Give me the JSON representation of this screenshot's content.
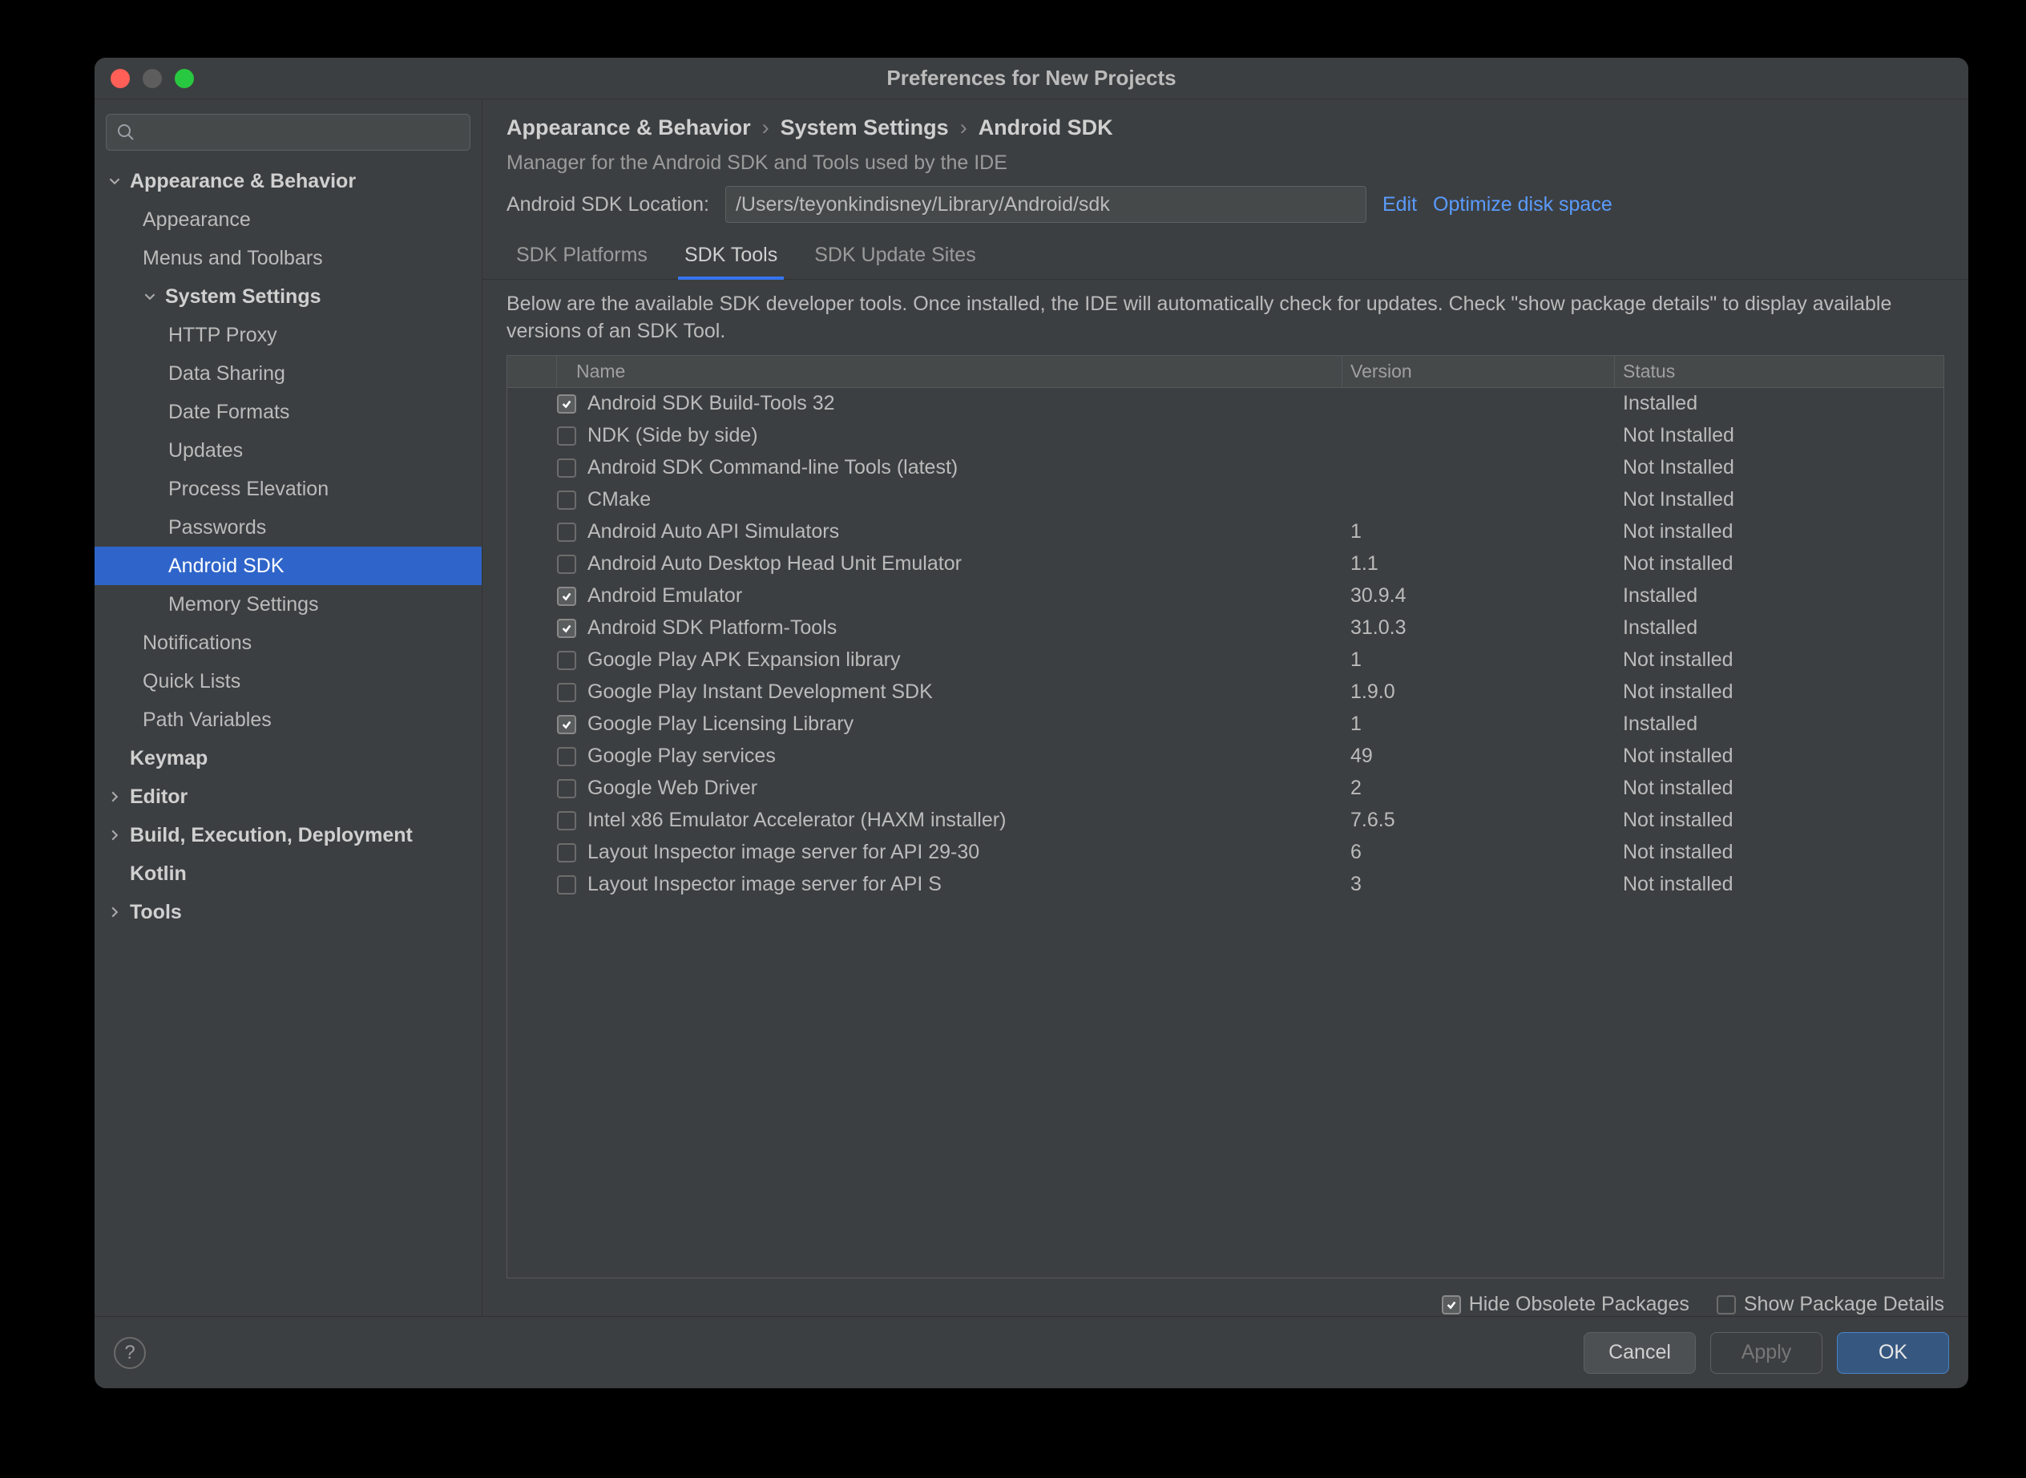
{
  "window": {
    "title": "Preferences for New Projects"
  },
  "sidebar": {
    "search_placeholder": "",
    "items": [
      {
        "label": "Appearance & Behavior",
        "bold": true,
        "expander": "down",
        "indent": 0
      },
      {
        "label": "Appearance",
        "indent": 1
      },
      {
        "label": "Menus and Toolbars",
        "indent": 1
      },
      {
        "label": "System Settings",
        "bold": true,
        "expander": "down",
        "indent": 1
      },
      {
        "label": "HTTP Proxy",
        "indent": 2
      },
      {
        "label": "Data Sharing",
        "indent": 2
      },
      {
        "label": "Date Formats",
        "indent": 2
      },
      {
        "label": "Updates",
        "indent": 2
      },
      {
        "label": "Process Elevation",
        "indent": 2
      },
      {
        "label": "Passwords",
        "indent": 2
      },
      {
        "label": "Android SDK",
        "indent": 2,
        "selected": true
      },
      {
        "label": "Memory Settings",
        "indent": 2
      },
      {
        "label": "Notifications",
        "indent": 1
      },
      {
        "label": "Quick Lists",
        "indent": 1
      },
      {
        "label": "Path Variables",
        "indent": 1
      },
      {
        "label": "Keymap",
        "bold": true,
        "indent": 0
      },
      {
        "label": "Editor",
        "bold": true,
        "expander": "right",
        "indent": 0
      },
      {
        "label": "Build, Execution, Deployment",
        "bold": true,
        "expander": "right",
        "indent": 0
      },
      {
        "label": "Kotlin",
        "bold": true,
        "indent": 0
      },
      {
        "label": "Tools",
        "bold": true,
        "expander": "right",
        "indent": 0
      }
    ]
  },
  "breadcrumb": {
    "a": "Appearance & Behavior",
    "b": "System Settings",
    "c": "Android SDK"
  },
  "manager_desc": "Manager for the Android SDK and Tools used by the IDE",
  "sdk_location": {
    "label": "Android SDK Location:",
    "value": "/Users/teyonkindisney/Library/Android/sdk",
    "edit": "Edit",
    "optimize": "Optimize disk space"
  },
  "tabs": [
    {
      "label": "SDK Platforms",
      "active": false
    },
    {
      "label": "SDK Tools",
      "active": true
    },
    {
      "label": "SDK Update Sites",
      "active": false
    }
  ],
  "tab_desc": "Below are the available SDK developer tools. Once installed, the IDE will automatically check for updates. Check \"show package details\" to display available versions of an SDK Tool.",
  "table": {
    "headers": {
      "name": "Name",
      "version": "Version",
      "status": "Status"
    },
    "rows": [
      {
        "checked": true,
        "name": "Android SDK Build-Tools 32",
        "version": "",
        "status": "Installed"
      },
      {
        "checked": false,
        "name": "NDK (Side by side)",
        "version": "",
        "status": "Not Installed"
      },
      {
        "checked": false,
        "name": "Android SDK Command-line Tools (latest)",
        "version": "",
        "status": "Not Installed"
      },
      {
        "checked": false,
        "name": "CMake",
        "version": "",
        "status": "Not Installed"
      },
      {
        "checked": false,
        "name": "Android Auto API Simulators",
        "version": "1",
        "status": "Not installed"
      },
      {
        "checked": false,
        "name": "Android Auto Desktop Head Unit Emulator",
        "version": "1.1",
        "status": "Not installed"
      },
      {
        "checked": true,
        "name": "Android Emulator",
        "version": "30.9.4",
        "status": "Installed"
      },
      {
        "checked": true,
        "name": "Android SDK Platform-Tools",
        "version": "31.0.3",
        "status": "Installed"
      },
      {
        "checked": false,
        "name": "Google Play APK Expansion library",
        "version": "1",
        "status": "Not installed"
      },
      {
        "checked": false,
        "name": "Google Play Instant Development SDK",
        "version": "1.9.0",
        "status": "Not installed"
      },
      {
        "checked": true,
        "name": "Google Play Licensing Library",
        "version": "1",
        "status": "Installed"
      },
      {
        "checked": false,
        "name": "Google Play services",
        "version": "49",
        "status": "Not installed"
      },
      {
        "checked": false,
        "name": "Google Web Driver",
        "version": "2",
        "status": "Not installed"
      },
      {
        "checked": false,
        "name": "Intel x86 Emulator Accelerator (HAXM installer)",
        "version": "7.6.5",
        "status": "Not installed"
      },
      {
        "checked": false,
        "name": "Layout Inspector image server for API 29-30",
        "version": "6",
        "status": "Not installed"
      },
      {
        "checked": false,
        "name": "Layout Inspector image server for API S",
        "version": "3",
        "status": "Not installed"
      }
    ]
  },
  "options": {
    "hide_obsolete": {
      "label": "Hide Obsolete Packages",
      "checked": true
    },
    "show_details": {
      "label": "Show Package Details",
      "checked": false
    }
  },
  "footer": {
    "cancel": "Cancel",
    "apply": "Apply",
    "ok": "OK"
  }
}
